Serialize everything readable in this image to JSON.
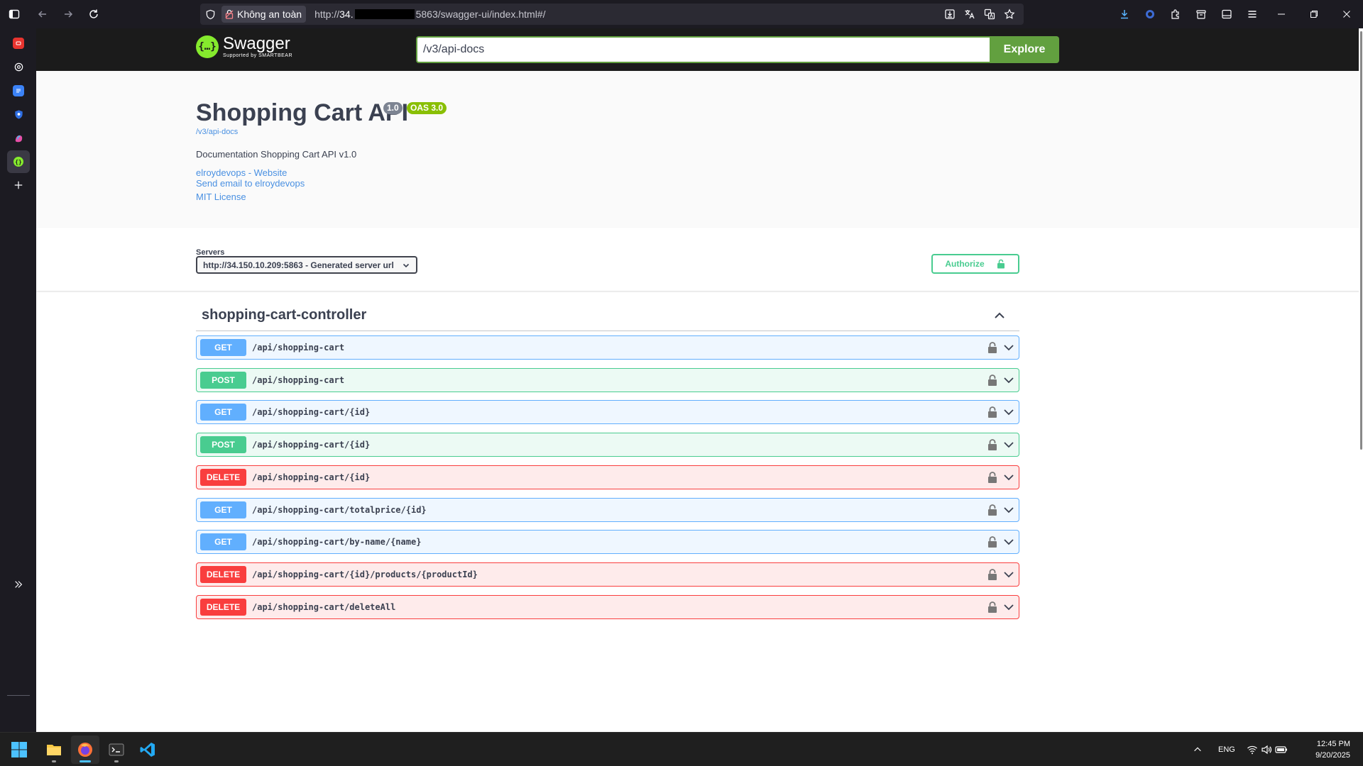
{
  "browser": {
    "security_label": "Không an toàn",
    "url_prefix": "http://",
    "url_host": "34.",
    "url_suffix": "5863/swagger-ui/index.html#/"
  },
  "swagger": {
    "brand_name": "Swagger",
    "brand_sub": "Supported by SMARTBEAR",
    "spec_url": "/v3/api-docs",
    "explore_label": "Explore"
  },
  "info": {
    "title": "Shopping Cart API",
    "version": "1.0",
    "oas": "OAS 3.0",
    "api_link": "/v3/api-docs",
    "description": "Documentation Shopping Cart API v1.0",
    "website_link": "elroydevops - Website",
    "email_link": "Send email to elroydevops",
    "license_link": "MIT License"
  },
  "servers": {
    "label": "Servers",
    "selected": "http://34.150.10.209:5863 - Generated server url",
    "authorize_label": "Authorize"
  },
  "tag": {
    "name": "shopping-cart-controller"
  },
  "operations": [
    {
      "method": "GET",
      "path": "/api/shopping-cart"
    },
    {
      "method": "POST",
      "path": "/api/shopping-cart"
    },
    {
      "method": "GET",
      "path": "/api/shopping-cart/{id}"
    },
    {
      "method": "POST",
      "path": "/api/shopping-cart/{id}"
    },
    {
      "method": "DELETE",
      "path": "/api/shopping-cart/{id}"
    },
    {
      "method": "GET",
      "path": "/api/shopping-cart/totalprice/{id}"
    },
    {
      "method": "GET",
      "path": "/api/shopping-cart/by-name/{name}"
    },
    {
      "method": "DELETE",
      "path": "/api/shopping-cart/{id}/products/{productId}"
    },
    {
      "method": "DELETE",
      "path": "/api/shopping-cart/deleteAll"
    }
  ],
  "taskbar": {
    "language": "ENG",
    "time": "12:45 PM",
    "date": "9/20/2025"
  },
  "colors": {
    "get": "#61affe",
    "post": "#49cc90",
    "delete": "#f93e3e",
    "swagger_green": "#62a03f",
    "swagger_logo": "#85ea2d"
  }
}
